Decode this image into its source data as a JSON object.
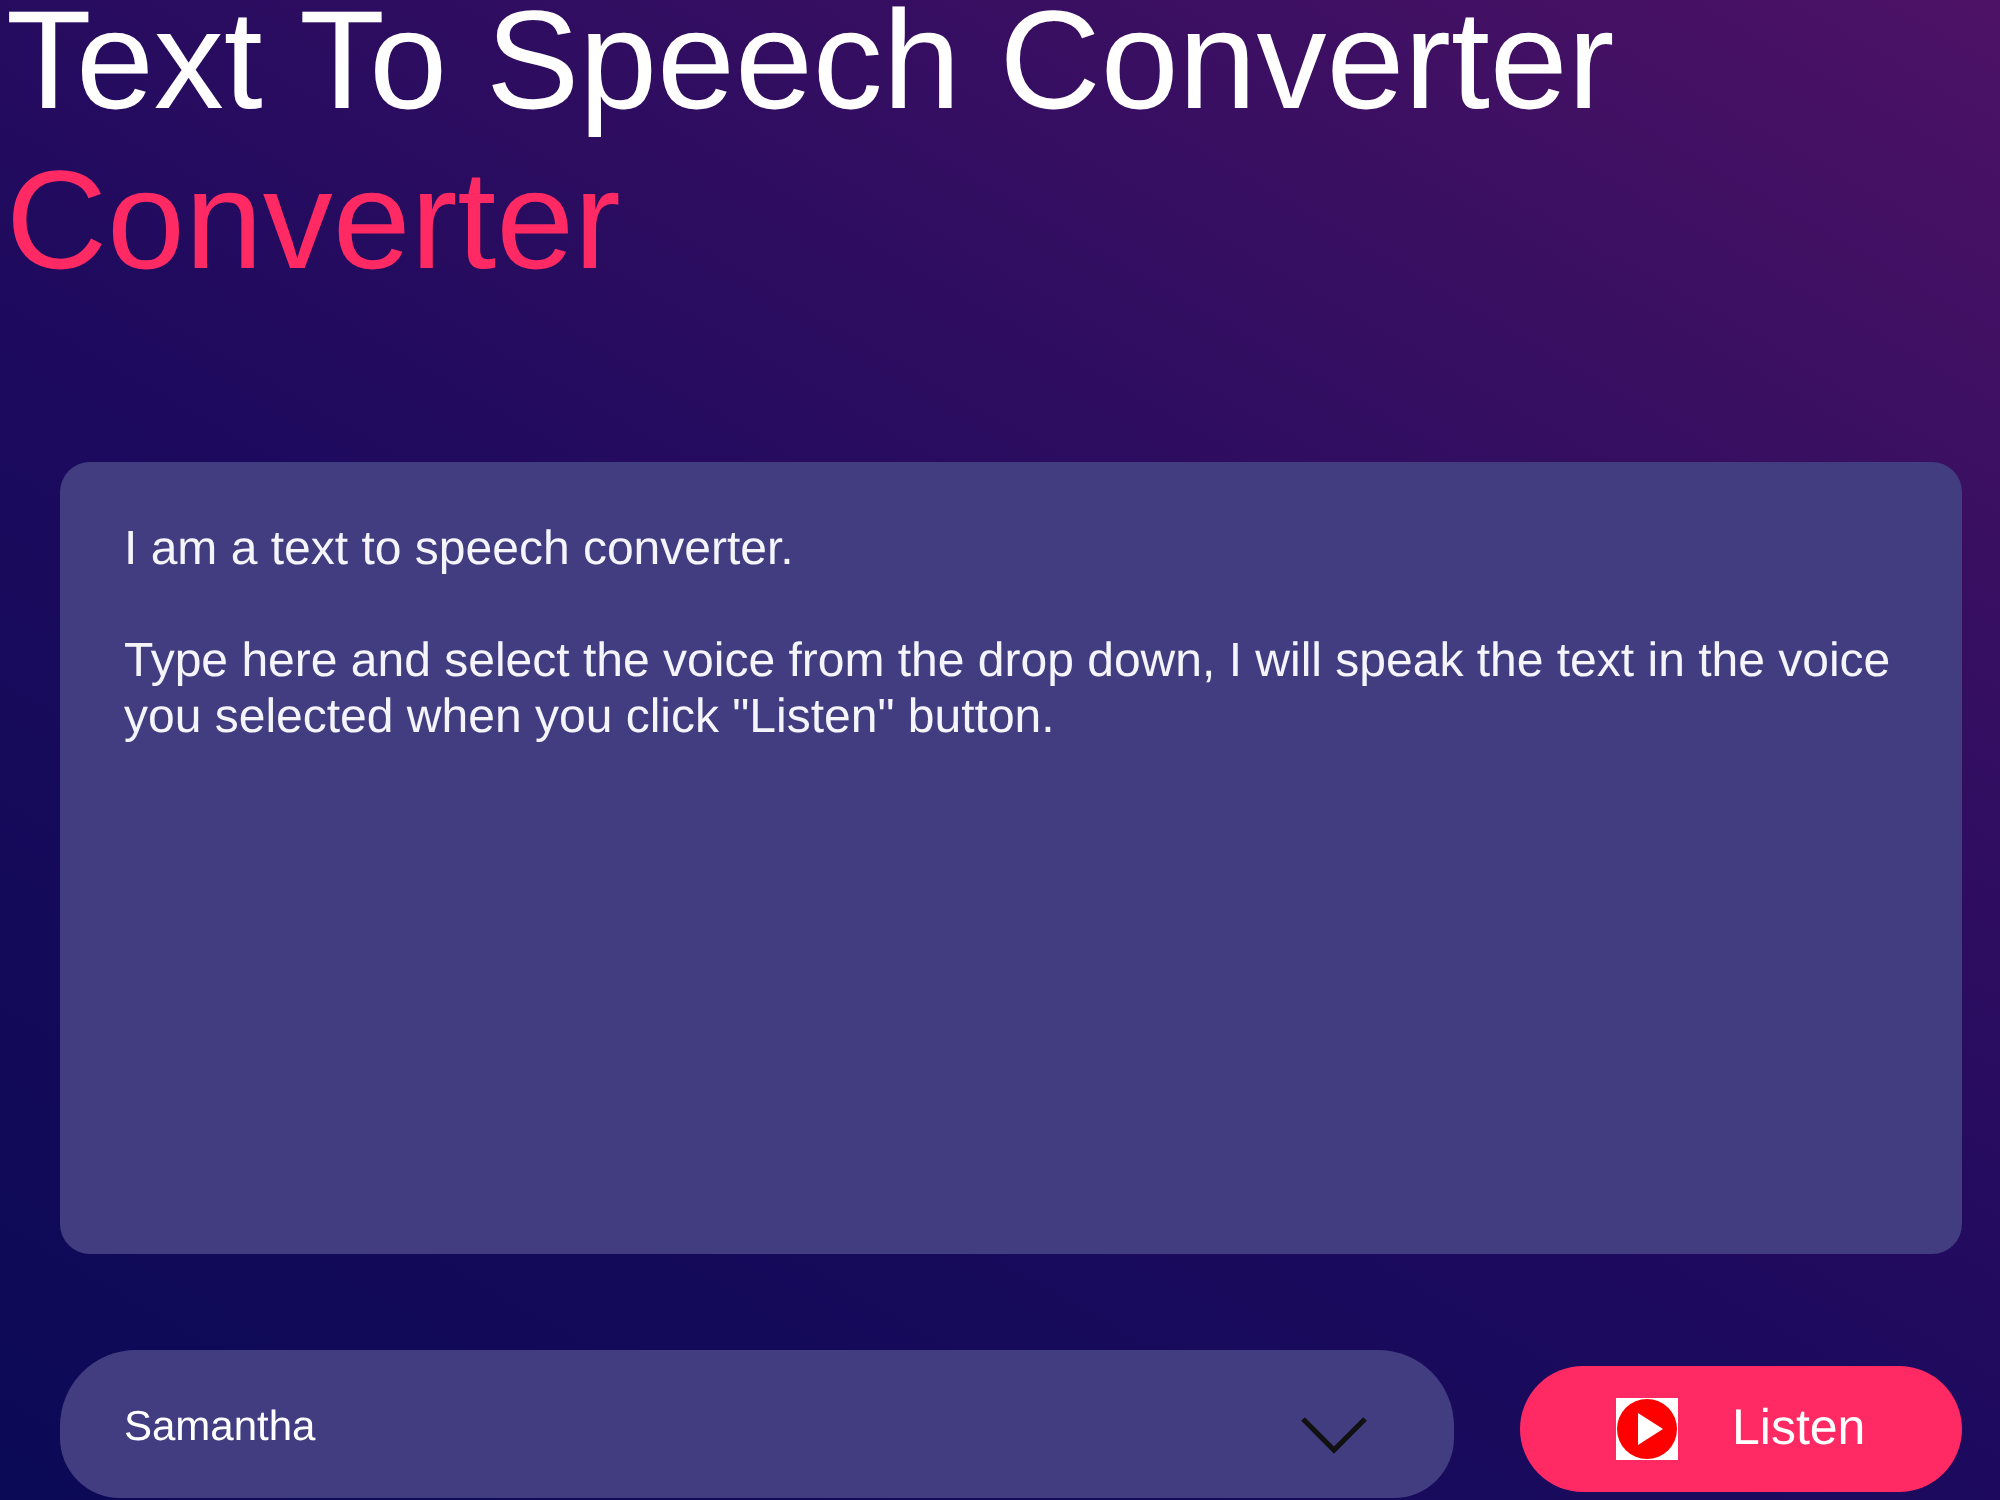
{
  "title": {
    "text": "Text To Speech Converter",
    "accent": "Converter"
  },
  "editor": {
    "value": "I am a text to speech converter.\n\nType here and select the voice from the drop down, I will speak the text in the voice you selected when you click \"Listen\" button."
  },
  "voice_select": {
    "value": "Samantha"
  },
  "listen_button": {
    "label": "Listen"
  }
}
